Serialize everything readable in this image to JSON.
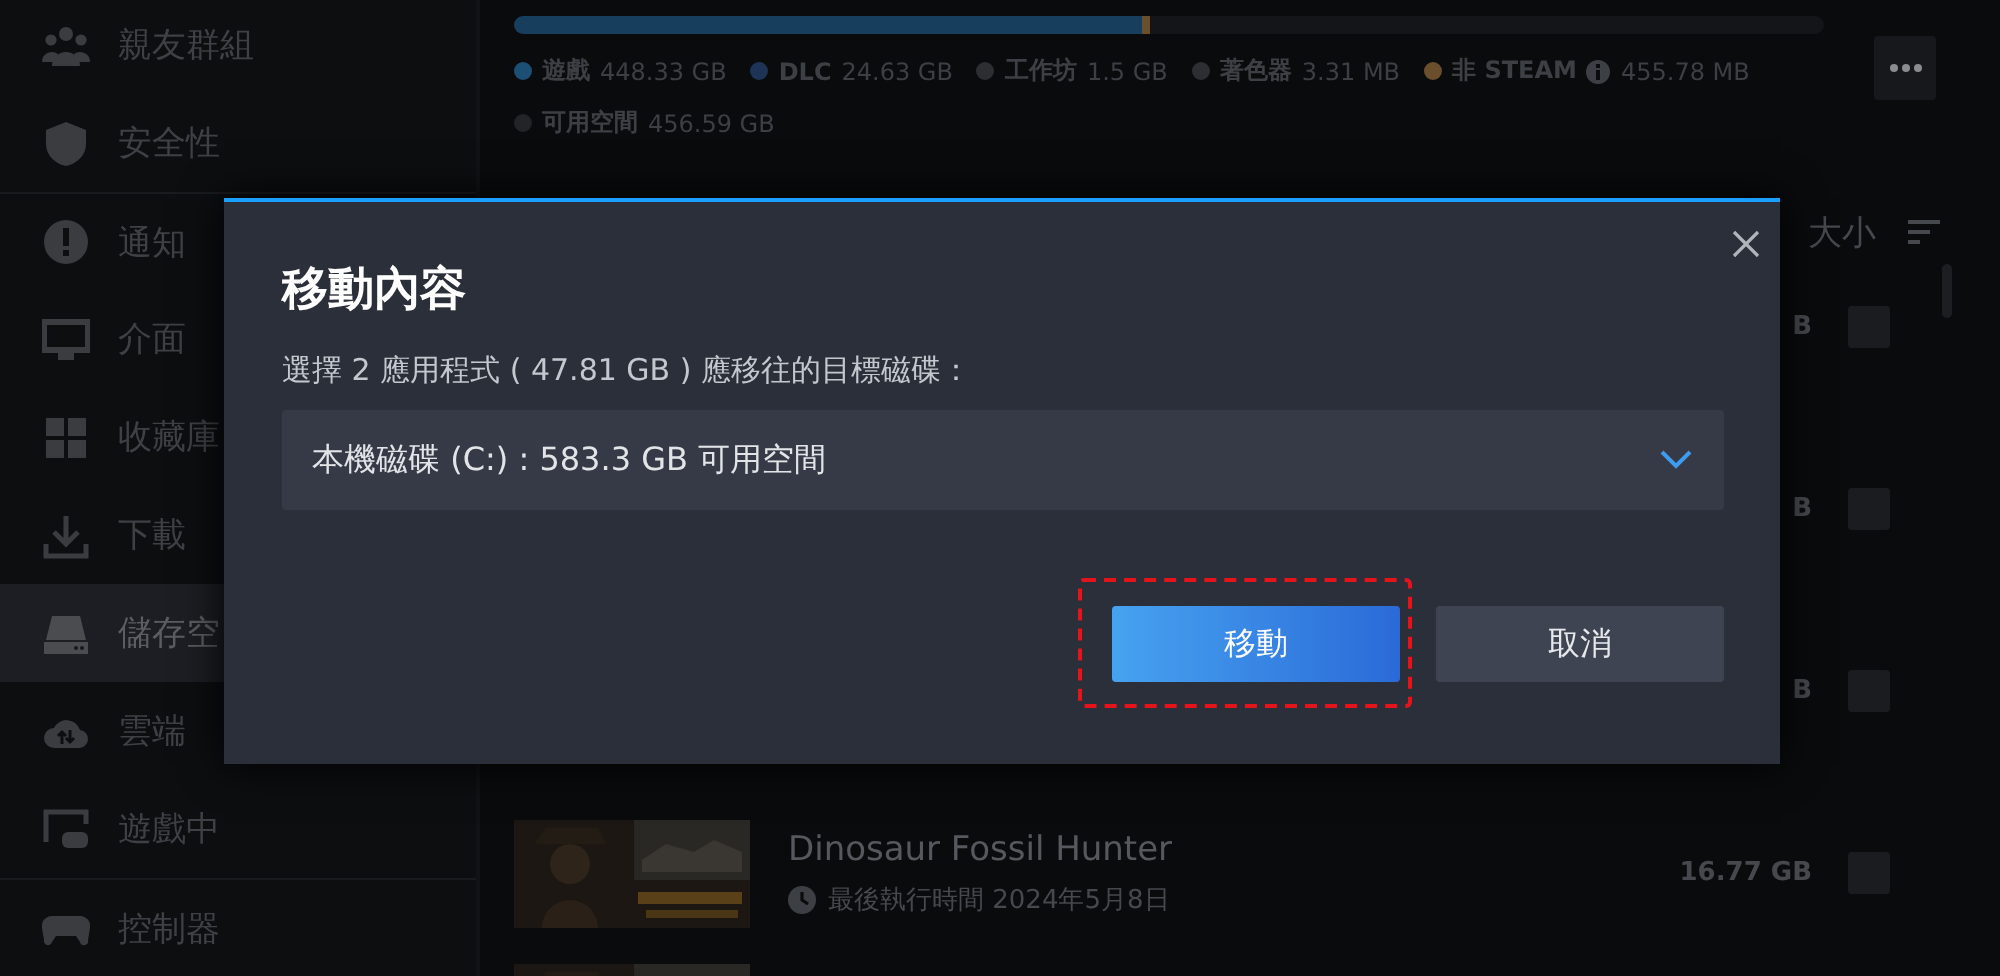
{
  "sidebar": {
    "items": [
      {
        "label": "親友群組",
        "selected": false
      },
      {
        "label": "安全性",
        "selected": false
      },
      {
        "label": "通知",
        "selected": false
      },
      {
        "label": "介面",
        "selected": false
      },
      {
        "label": "收藏庫",
        "selected": false
      },
      {
        "label": "下載",
        "selected": false
      },
      {
        "label": "儲存空",
        "selected": true
      },
      {
        "label": "雲端",
        "selected": false
      },
      {
        "label": "遊戲中",
        "selected": false
      },
      {
        "label": "控制器",
        "selected": false
      }
    ]
  },
  "storage": {
    "level": 0.48,
    "legend": [
      {
        "label": "遊戲",
        "value": "448.33 GB",
        "color": "#1b4f74",
        "kind": "plain"
      },
      {
        "label": "DLC",
        "value": "24.63 GB",
        "color": "#1d3456",
        "kind": "plain"
      },
      {
        "label": "工作坊",
        "value": "1.5 GB",
        "color": "#2c2e32",
        "kind": "plain"
      },
      {
        "label": "著色器",
        "value": "3.31 MB",
        "color": "#2c2e32",
        "kind": "plain"
      },
      {
        "label": "非 STEAM",
        "value": "455.78 MB",
        "color": "#6b4f2c",
        "kind": "info"
      },
      {
        "label": "可用空間",
        "value": "456.59 GB",
        "color": "#222428",
        "kind": "plain"
      }
    ]
  },
  "list": {
    "header": "大小",
    "rows": [
      {
        "kind": "covered",
        "size": "B",
        "checked": false
      },
      {
        "kind": "covered",
        "size": "B",
        "checked": false
      },
      {
        "kind": "covered",
        "size": "B",
        "checked": false
      },
      {
        "kind": "game",
        "title": "Dinosaur Fossil Hunter",
        "last_played": "最後執行時間 2024年5月8日",
        "size": "16.77 GB",
        "checked": false
      },
      {
        "kind": "peek"
      }
    ]
  },
  "dialog": {
    "title": "移動內容",
    "message": "選擇 2 應用程式 ( 47.81 GB ) 應移往的目標磁碟：",
    "drive": "本機磁碟 (C:) : 583.3 GB 可用空間",
    "buttons": [
      {
        "label": "移動",
        "kind": "primary",
        "highlighted": true
      },
      {
        "label": "取消",
        "kind": "secondary",
        "highlighted": false
      }
    ]
  }
}
